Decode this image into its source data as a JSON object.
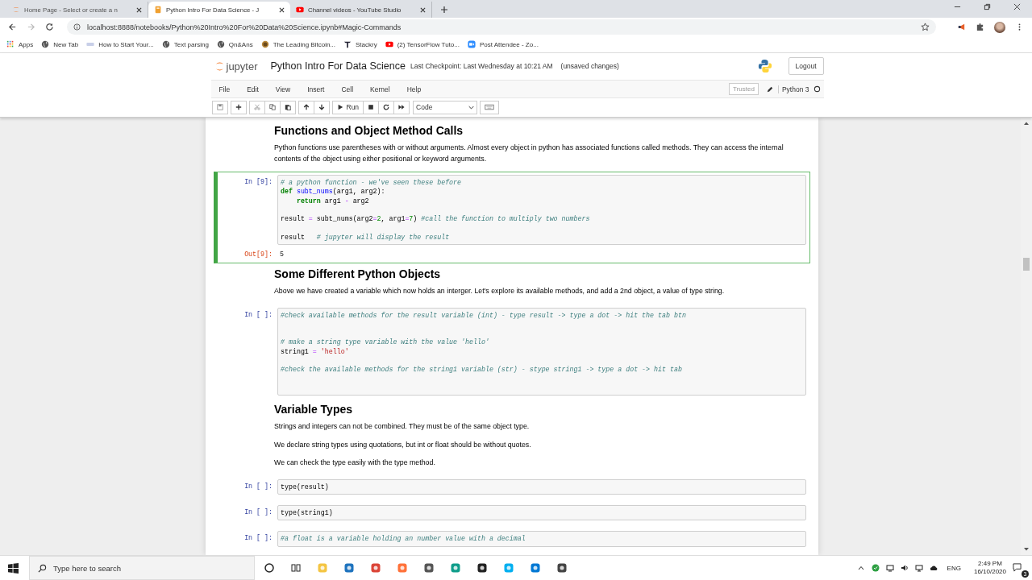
{
  "browser": {
    "tabs": [
      {
        "title": "Home Page - Select or create a n",
        "selected": false
      },
      {
        "title": "Python Intro For Data Science - J",
        "selected": true
      },
      {
        "title": "Channel videos - YouTube Studio",
        "selected": false
      }
    ],
    "url": "localhost:8888/notebooks/Python%20Intro%20For%20Data%20Science.ipynb#Magic-Commands",
    "bookmarks": [
      "Apps",
      "New Tab",
      "How to Start Your...",
      "Text parsing",
      "Qn&Ans",
      "The Leading Bitcoin...",
      "Stackry",
      "(2) TensorFlow Tuto...",
      "Post Attendee - Zo..."
    ]
  },
  "jupyter": {
    "logo_text": "jupyter",
    "title": "Python Intro For Data Science",
    "checkpoint": "Last Checkpoint: Last Wednesday at 10:21 AM",
    "unsaved": "(unsaved changes)",
    "logout": "Logout",
    "menu": [
      "File",
      "Edit",
      "View",
      "Insert",
      "Cell",
      "Kernel",
      "Help"
    ],
    "trusted": "Trusted",
    "kernel": "Python 3",
    "run_label": "Run",
    "cell_type": "Code"
  },
  "cells": [
    {
      "kind": "heading",
      "text": "Functions and Object Method Calls"
    },
    {
      "kind": "text",
      "text": "Python functions use parentheses with or without arguments. Almost every object in python has associated functions called methods. They can access the internal contents of the object using either positional or keyword arguments."
    },
    {
      "kind": "code",
      "prompt": "In [9]:",
      "selected": true,
      "lines": [
        {
          "kind": "code",
          "segs": [
            {
              "t": "# a python function - we've seen these before",
              "kind": "comment"
            }
          ]
        },
        {
          "kind": "code",
          "segs": [
            {
              "t": "def",
              "kind": "keyword"
            },
            {
              "t": " subt_nums",
              "kind": "function"
            },
            {
              "t": "(arg1, arg2):",
              "kind": "plain"
            }
          ]
        },
        {
          "kind": "code",
          "segs": [
            {
              "t": "    return",
              "kind": "keyword"
            },
            {
              "t": " arg1 ",
              "kind": "plain"
            },
            {
              "t": "-",
              "kind": "operator"
            },
            {
              "t": " arg2",
              "kind": "plain"
            }
          ]
        },
        {
          "kind": "blank"
        },
        {
          "kind": "code",
          "segs": [
            {
              "t": "result ",
              "kind": "plain"
            },
            {
              "t": "=",
              "kind": "operator"
            },
            {
              "t": " subt_nums(arg2",
              "kind": "plain"
            },
            {
              "t": "=",
              "kind": "operator"
            },
            {
              "t": "2",
              "kind": "number"
            },
            {
              "t": ", arg1",
              "kind": "plain"
            },
            {
              "t": "=",
              "kind": "operator"
            },
            {
              "t": "7",
              "kind": "number"
            },
            {
              "t": ") ",
              "kind": "plain"
            },
            {
              "t": "#call the function to multiply two numbers",
              "kind": "comment"
            }
          ]
        },
        {
          "kind": "blank"
        },
        {
          "kind": "code",
          "segs": [
            {
              "t": "result   ",
              "kind": "plain"
            },
            {
              "t": "# jupyter will display the result",
              "kind": "comment"
            }
          ]
        }
      ],
      "output": {
        "prompt": "Out[9]:",
        "text": "5"
      }
    },
    {
      "kind": "heading",
      "text": "Some Different Python Objects"
    },
    {
      "kind": "text",
      "text": "Above we have created a variable which now holds an interger. Let's explore its available methods, and add a 2nd object, a value of type string."
    },
    {
      "kind": "code",
      "prompt": "In [ ]:",
      "selected": false,
      "lines": [
        {
          "kind": "code",
          "segs": [
            {
              "t": "#check available methods for the result variable (int) - type result -> type a dot -> hit the tab btn",
              "kind": "comment"
            }
          ]
        },
        {
          "kind": "blank"
        },
        {
          "kind": "blank"
        },
        {
          "kind": "code",
          "segs": [
            {
              "t": "# make a string type variable with the value 'hello'",
              "kind": "comment"
            }
          ]
        },
        {
          "kind": "code",
          "segs": [
            {
              "t": "string1 ",
              "kind": "plain"
            },
            {
              "t": "=",
              "kind": "operator"
            },
            {
              "t": " 'hello'",
              "kind": "string"
            }
          ]
        },
        {
          "kind": "blank"
        },
        {
          "kind": "code",
          "segs": [
            {
              "t": "#check the available methods for the string1 variable (str) - stype string1 -> type a dot -> hit tab",
              "kind": "comment"
            }
          ]
        },
        {
          "kind": "blank"
        },
        {
          "kind": "blank"
        }
      ]
    },
    {
      "kind": "heading",
      "text": "Variable Types"
    },
    {
      "kind": "text",
      "text": "Strings and integers can not be combined. They must be of the same object type."
    },
    {
      "kind": "text",
      "text": "We declare string types using quotations, but int or float should be without quotes."
    },
    {
      "kind": "text",
      "text": "We can check the type easily with the type method."
    },
    {
      "kind": "code",
      "prompt": "In [ ]:",
      "selected": false,
      "lines": [
        {
          "kind": "code",
          "segs": [
            {
              "t": "type(result)",
              "kind": "plain"
            }
          ]
        }
      ]
    },
    {
      "kind": "code",
      "prompt": "In [ ]:",
      "selected": false,
      "lines": [
        {
          "kind": "code",
          "segs": [
            {
              "t": "type(string1)",
              "kind": "plain"
            }
          ]
        }
      ]
    },
    {
      "kind": "code",
      "prompt": "In [ ]:",
      "selected": false,
      "lines": [
        {
          "kind": "code",
          "segs": [
            {
              "t": "#a float is a variable holding an number value with a decimal",
              "kind": "comment"
            }
          ]
        }
      ]
    }
  ],
  "taskbar": {
    "search_placeholder": "Type here to search",
    "language": "ENG",
    "time": "2:49 PM",
    "date": "16/10/2020",
    "notifications": "3"
  }
}
